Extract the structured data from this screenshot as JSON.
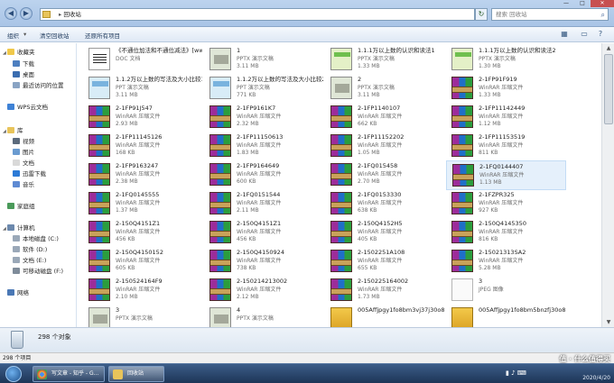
{
  "window": {
    "address": "回收站",
    "search_placeholder": "搜索 回收站",
    "controls": [
      "—",
      "□",
      "✕"
    ]
  },
  "toolbar": {
    "organize": "组织",
    "empty_bin": "清空回收站",
    "restore_all": "还原所有项目"
  },
  "sidebar": {
    "favorites": "收藏夹",
    "fav_items": [
      "下载",
      "桌面",
      "最近访问的位置"
    ],
    "wps": "WPS云文档",
    "libraries": "库",
    "lib_items": [
      "视频",
      "图片",
      "文档",
      "迅雷下载",
      "音乐"
    ],
    "homegroup": "家庭组",
    "computer": "计算机",
    "drives": [
      "本地磁盘 (C:)",
      "软件 (D:)",
      "文档 (E:)",
      "可移动磁盘 (F:)"
    ],
    "network": "网络"
  },
  "files": [
    {
      "name": "《不通位加法和不通位减法》[www.mianfeiwendang.com]",
      "type": "DOC 文档",
      "size": "",
      "kind": "doc"
    },
    {
      "name": "1",
      "type": "PPTX 演示文稿",
      "size": "3.11 MB",
      "kind": "pptx"
    },
    {
      "name": "1.1.1万以上数的认识和读法1",
      "type": "PPTX 演示文稿",
      "size": "1.33 MB",
      "kind": "pptx-green"
    },
    {
      "name": "1.1.1万以上数的认识和读法2",
      "type": "PPTX 演示文稿",
      "size": "1.30 MB",
      "kind": "pptx-green"
    },
    {
      "name": "1.1.2万以上数的写法及大小比较1",
      "type": "PPT 演示文稿",
      "size": "3.11 MB",
      "kind": "pptx-blue"
    },
    {
      "name": "1.1.2万以上数的写法及大小比较2",
      "type": "PPT 演示文稿",
      "size": "771 KB",
      "kind": "pptx-blue"
    },
    {
      "name": "2",
      "type": "PPTX 演示文稿",
      "size": "3.11 MB",
      "kind": "pptx"
    },
    {
      "name": "2-1FP91F919",
      "type": "WinRAR 压缩文件",
      "size": "1.33 MB",
      "kind": "rar"
    },
    {
      "name": "2-1FP91J547",
      "type": "WinRAR 压缩文件",
      "size": "2.93 MB",
      "kind": "rar"
    },
    {
      "name": "2-1FP9161K7",
      "type": "WinRAR 压缩文件",
      "size": "2.32 MB",
      "kind": "rar"
    },
    {
      "name": "2-1FP1140107",
      "type": "WinRAR 压缩文件",
      "size": "662 KB",
      "kind": "rar"
    },
    {
      "name": "2-1FP11142449",
      "type": "WinRAR 压缩文件",
      "size": "1.12 MB",
      "kind": "rar"
    },
    {
      "name": "2-1FP11145126",
      "type": "WinRAR 压缩文件",
      "size": "168 KB",
      "kind": "rar"
    },
    {
      "name": "2-1FP11150613",
      "type": "WinRAR 压缩文件",
      "size": "1.83 MB",
      "kind": "rar"
    },
    {
      "name": "2-1FP11152202",
      "type": "WinRAR 压缩文件",
      "size": "1.05 MB",
      "kind": "rar"
    },
    {
      "name": "2-1FP11153519",
      "type": "WinRAR 压缩文件",
      "size": "811 KB",
      "kind": "rar"
    },
    {
      "name": "2-1FP9163247",
      "type": "WinRAR 压缩文件",
      "size": "2.38 MB",
      "kind": "rar"
    },
    {
      "name": "2-1FP9164649",
      "type": "WinRAR 压缩文件",
      "size": "600 KB",
      "kind": "rar"
    },
    {
      "name": "2-1FQ015458",
      "type": "WinRAR 压缩文件",
      "size": "2.70 MB",
      "kind": "rar"
    },
    {
      "name": "2-1FQ0144407",
      "type": "WinRAR 压缩文件",
      "size": "1.13 MB",
      "kind": "rar"
    },
    {
      "name": "2-1FQ0145555",
      "type": "WinRAR 压缩文件",
      "size": "1.37 MB",
      "kind": "rar"
    },
    {
      "name": "2-1FQ0151544",
      "type": "WinRAR 压缩文件",
      "size": "2.11 MB",
      "kind": "rar"
    },
    {
      "name": "2-1FQ0153330",
      "type": "WinRAR 压缩文件",
      "size": "638 KB",
      "kind": "rar"
    },
    {
      "name": "2-1FZPR325",
      "type": "WinRAR 压缩文件",
      "size": "927 KB",
      "kind": "rar"
    },
    {
      "name": "2-150Q4151Z1",
      "type": "WinRAR 压缩文件",
      "size": "456 KB",
      "kind": "rar"
    },
    {
      "name": "2-150Q4151Z1",
      "type": "WinRAR 压缩文件",
      "size": "456 KB",
      "kind": "rar"
    },
    {
      "name": "2-150Q4152H5",
      "type": "WinRAR 压缩文件",
      "size": "405 KB",
      "kind": "rar"
    },
    {
      "name": "2-150Q4145350",
      "type": "WinRAR 压缩文件",
      "size": "816 KB",
      "kind": "rar"
    },
    {
      "name": "2-150Q4150152",
      "type": "WinRAR 压缩文件",
      "size": "605 KB",
      "kind": "rar"
    },
    {
      "name": "2-150Q4150924",
      "type": "WinRAR 压缩文件",
      "size": "738 KB",
      "kind": "rar"
    },
    {
      "name": "2-1502251A108",
      "type": "WinRAR 压缩文件",
      "size": "655 KB",
      "kind": "rar"
    },
    {
      "name": "2-15021313SA2",
      "type": "WinRAR 压缩文件",
      "size": "5.28 MB",
      "kind": "rar"
    },
    {
      "name": "2-150524164F9",
      "type": "WinRAR 压缩文件",
      "size": "2.10 MB",
      "kind": "rar"
    },
    {
      "name": "2-150214213002",
      "type": "WinRAR 压缩文件",
      "size": "2.12 MB",
      "kind": "rar"
    },
    {
      "name": "2-150225164002",
      "type": "WinRAR 压缩文件",
      "size": "1.73 MB",
      "kind": "rar"
    },
    {
      "name": "3",
      "type": "JPEG 图像",
      "size": "",
      "kind": "jpeg"
    },
    {
      "name": "3",
      "type": "PPTX 演示文稿",
      "size": "",
      "kind": "pptx"
    },
    {
      "name": "4",
      "type": "PPTX 演示文稿",
      "size": "",
      "kind": "pptx"
    },
    {
      "name": "005Affjpgy1fo8bm3vj37j30o819imza",
      "type": "",
      "size": "",
      "kind": "jpegy"
    },
    {
      "name": "005Affjpgy1fo8bm5bnzfj30o819ipsb",
      "type": "",
      "size": "",
      "kind": "jpegy"
    }
  ],
  "details": {
    "count": "298 个对象"
  },
  "statusbar": {
    "text": "298 个项目"
  },
  "taskbar": {
    "tasks": [
      "写文章 - 知乎 - G...",
      "回收站"
    ],
    "time": "",
    "date": "2020/4/20"
  },
  "watermark": "值 · 什么值得买"
}
